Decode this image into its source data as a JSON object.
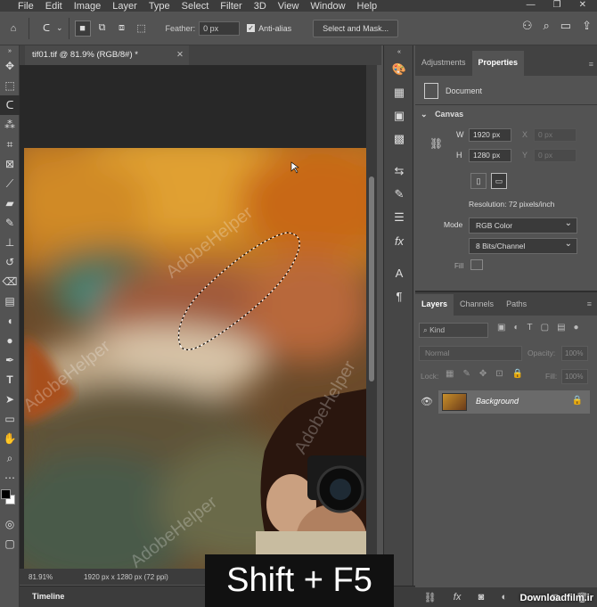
{
  "menu": [
    "File",
    "Edit",
    "Image",
    "Layer",
    "Type",
    "Select",
    "Filter",
    "3D",
    "View",
    "Window",
    "Help"
  ],
  "options": {
    "feather_label": "Feather:",
    "feather_value": "0 px",
    "antialias_label": "Anti-alias",
    "select_mask_label": "Select and Mask..."
  },
  "document": {
    "tab_title": "tif01.tif @ 81.9% (RGB/8#) *",
    "zoom": "81.91%",
    "info": "1920 px x 1280 px (72 ppi)",
    "watermark": "AdobeHelper"
  },
  "timeline": {
    "label": "Timeline"
  },
  "shortcut": "Shift + F5",
  "properties": {
    "tabs": [
      "Adjustments",
      "Properties"
    ],
    "doc_label": "Document",
    "canvas_label": "Canvas",
    "w_label": "W",
    "w_value": "1920 px",
    "h_label": "H",
    "h_value": "1280 px",
    "x_label": "X",
    "x_value": "0 px",
    "y_label": "Y",
    "y_value": "0 px",
    "resolution": "Resolution: 72 pixels/inch",
    "mode_label": "Mode",
    "mode_value": "RGB Color",
    "depth_value": "8 Bits/Channel",
    "fill_label": "Fill"
  },
  "layers": {
    "tabs": [
      "Layers",
      "Channels",
      "Paths"
    ],
    "kind": "Kind",
    "blend": "Normal",
    "opacity_label": "Opacity:",
    "opacity_value": "100%",
    "lock_label": "Lock:",
    "fill_label": "Fill:",
    "fill_value": "100%",
    "layer_name": "Background"
  },
  "site_watermark": "Downloadfilm.ir"
}
